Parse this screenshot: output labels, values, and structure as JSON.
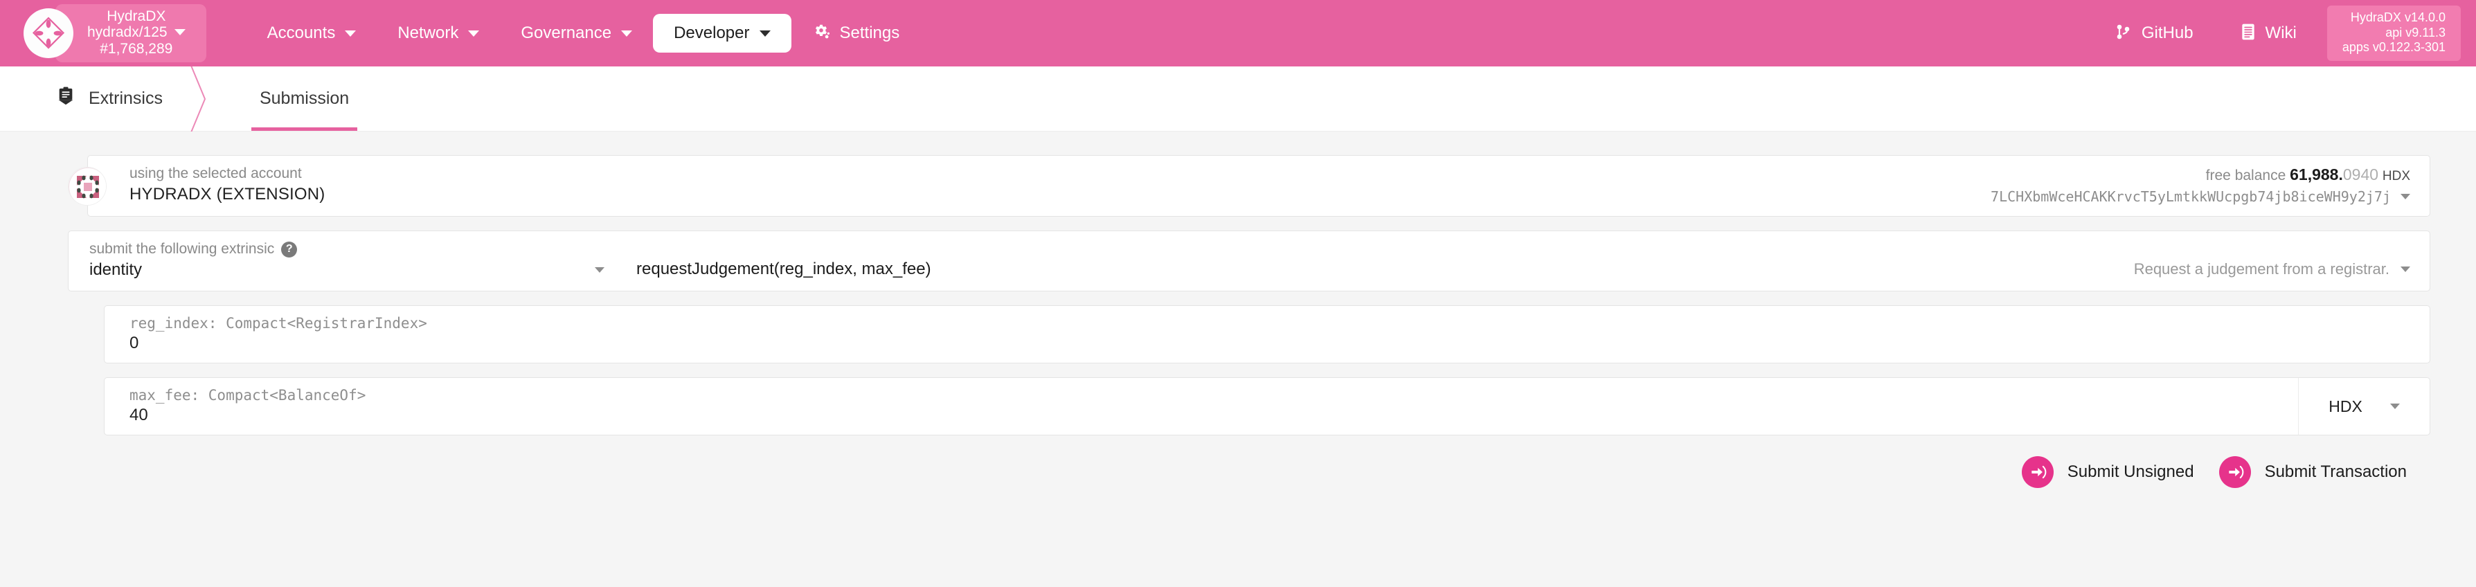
{
  "header": {
    "brand": {
      "logo_icon": "hydradx-diamond-logo",
      "chain_name": "HydraDX",
      "chain_spec": "hydradx/125",
      "block_number": "#1,768,289"
    },
    "nav": [
      {
        "label": "Accounts",
        "has_caret": true,
        "active": false
      },
      {
        "label": "Network",
        "has_caret": true,
        "active": false
      },
      {
        "label": "Governance",
        "has_caret": true,
        "active": false
      },
      {
        "label": "Developer",
        "has_caret": true,
        "active": true
      },
      {
        "label": "Settings",
        "has_caret": false,
        "active": false,
        "icon": "gear-icon"
      }
    ],
    "external_links": [
      {
        "label": "GitHub",
        "icon": "git-branch-icon"
      },
      {
        "label": "Wiki",
        "icon": "book-icon"
      }
    ],
    "version": {
      "line1": "HydraDX v14.0.0",
      "line2": "api v9.11.3",
      "line3": "apps v0.122.3-301"
    },
    "accent_color": "#e6619f"
  },
  "tabs": [
    {
      "label": "Extrinsics",
      "icon": "clipboard-icon",
      "active": false
    },
    {
      "label": "Submission",
      "icon": "",
      "active": true
    }
  ],
  "account": {
    "identicon": "account-identicon",
    "label": "using the selected account",
    "value": "HYDRADX (EXTENSION)",
    "balance_label": "free balance",
    "balance_int": "61,988.",
    "balance_dec": "0940",
    "balance_unit": "HDX",
    "address": "7LCHXbmWceHCAKKrvcT5yLmtkkWUcpgb74jb8iceWH9y2j7j"
  },
  "extrinsic": {
    "label": "submit the following extrinsic",
    "help_icon": "question-mark-icon",
    "pallet": "identity",
    "method": "requestJudgement(reg_index, max_fee)",
    "description": "Request a judgement from a registrar."
  },
  "params": [
    {
      "label": "reg_index: Compact<RegistrarIndex>",
      "value": "0",
      "unit": null
    },
    {
      "label": "max_fee: Compact<BalanceOf>",
      "value": "40",
      "unit": "HDX"
    }
  ],
  "buttons": [
    {
      "label": "Submit Unsigned",
      "icon": "sign-in-icon",
      "color": "#e6338b"
    },
    {
      "label": "Submit Transaction",
      "icon": "sign-in-icon",
      "color": "#e6338b"
    }
  ]
}
